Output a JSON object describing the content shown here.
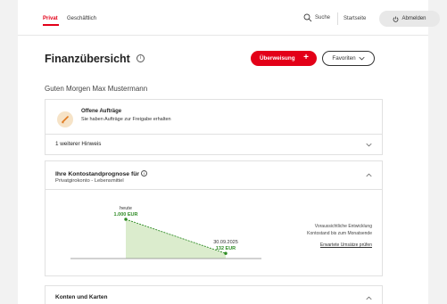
{
  "nav": {
    "tabs": [
      "Privat",
      "Geschäftlich"
    ],
    "search_label": "Suche",
    "home_label": "Startseite",
    "logout_label": "Abmelden"
  },
  "header": {
    "title": "Finanzübersicht",
    "transfer_button": "Überweisung",
    "favorites_button": "Favoriten"
  },
  "greeting": "Guten Morgen Max Mustermann",
  "orders": {
    "title": "Offene Aufträge",
    "subtitle": "Sie haben Aufträge zur Freigabe erhalten",
    "hint": "1 weiterer Hinweis"
  },
  "forecast": {
    "title": "Ihre Kontostandprognose für",
    "account": "Privatgirokonto - Lebensmittel",
    "description_line1": "Voraussichtliche Entwicklung",
    "description_line2": "Kontostand bis zum Monatsende",
    "link": "Erwartete Umsätze prüfen"
  },
  "chart_data": {
    "type": "area",
    "points": [
      {
        "x_label": "heute",
        "value": 1000,
        "value_label": "1.000 EUR"
      },
      {
        "x_label": "30.09.2025",
        "value": 132,
        "value_label": "132 EUR"
      }
    ]
  },
  "accounts": {
    "title": "Konten und Karten"
  },
  "colors": {
    "brand_red": "#e30018",
    "chart_green": "#2e8b24",
    "chart_fill": "#dbeccd"
  }
}
